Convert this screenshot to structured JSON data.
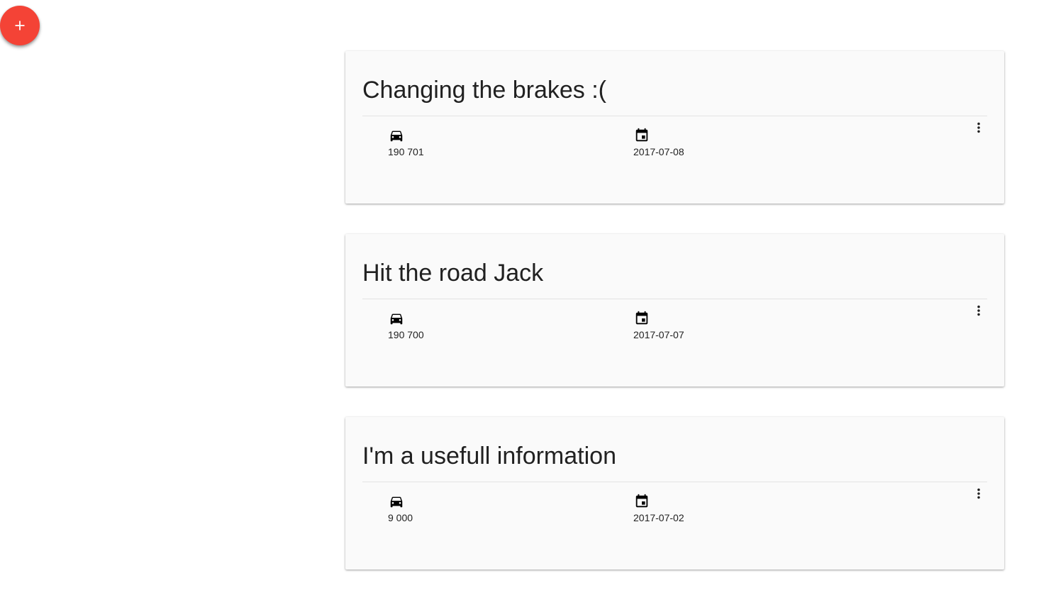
{
  "fab": {
    "icon": "plus-icon",
    "color": "#f44336"
  },
  "entries": [
    {
      "title": "Changing the brakes :(",
      "mileage": "190 701",
      "date": "2017-07-08"
    },
    {
      "title": "Hit the road Jack",
      "mileage": "190 700",
      "date": "2017-07-07"
    },
    {
      "title": "I'm a usefull information",
      "mileage": "9 000",
      "date": "2017-07-02"
    }
  ],
  "icons": {
    "mileage": "car-icon",
    "date": "calendar-icon",
    "menu": "more-vert-icon"
  }
}
